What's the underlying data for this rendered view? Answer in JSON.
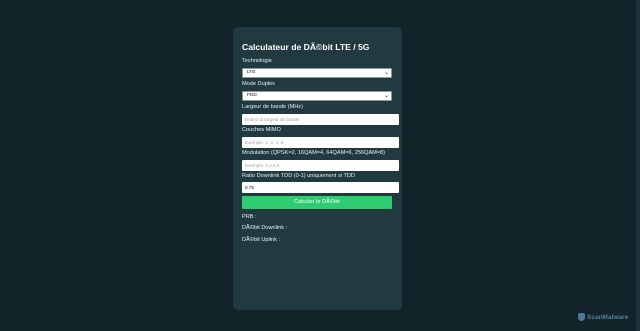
{
  "form": {
    "title": "Calculateur de DÃ©bit LTE / 5G",
    "technology": {
      "label": "Technologie",
      "selected": "LTE"
    },
    "duplex": {
      "label": "Mode Duplex",
      "selected": "FDD"
    },
    "bandwidth": {
      "label": "Largeur de bande (MHz)",
      "placeholder": "Entrez la largeur de bande",
      "value": ""
    },
    "mimo": {
      "label": "Couches MIMO",
      "placeholder": "Exemple: 1, 2, 4, 8",
      "value": ""
    },
    "modulation": {
      "label": "Modulation (QPSK=2, 16QAM=4, 64QAM=6, 256QAM=8)",
      "placeholder": "Exemple: 2,4,6,8",
      "value": ""
    },
    "tdd_ratio": {
      "label": "Ratio Downlink TDD (0-1) uniquement si TDD",
      "placeholder": "",
      "value": "0.75"
    },
    "calculate_label": "Calculer le DÃ©bit"
  },
  "results": {
    "prb_label": "PRB :",
    "downlink_label": "DÃ©bit Downlink :",
    "uplink_label": "DÃ©bit Uplink :"
  },
  "watermark": {
    "text": "ScanMalware",
    "icon": "shield-icon"
  },
  "colors": {
    "background": "#12242a",
    "card": "#203a40",
    "accent": "#2ecc71"
  }
}
